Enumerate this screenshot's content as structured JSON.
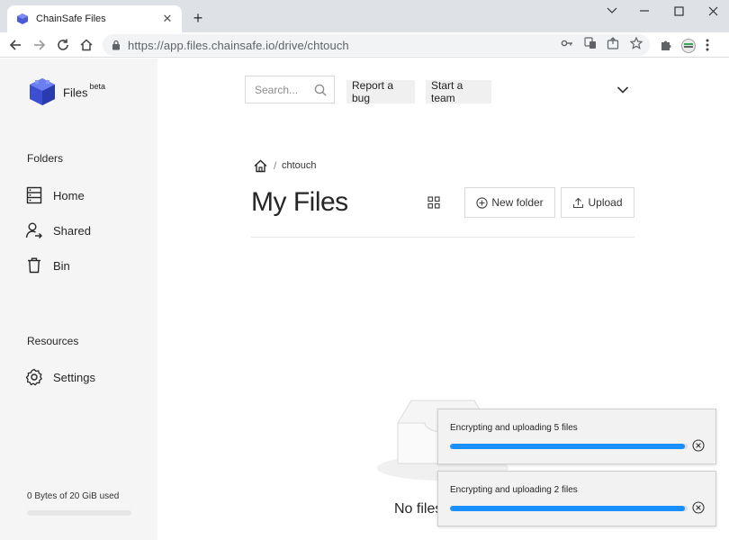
{
  "browser": {
    "tab_title": "ChainSafe Files",
    "tab_close": "✕",
    "new_tab": "+",
    "url": "https://app.files.chainsafe.io/drive/chtouch",
    "window_controls": [
      "minimize",
      "maximize",
      "close"
    ]
  },
  "sidebar": {
    "brand": "Files",
    "brand_badge": "beta",
    "folders_label": "Folders",
    "folders": [
      {
        "label": "Home",
        "icon": "home-list-icon"
      },
      {
        "label": "Shared",
        "icon": "shared-users-icon"
      },
      {
        "label": "Bin",
        "icon": "trash-icon"
      }
    ],
    "resources_label": "Resources",
    "settings_label": "Settings",
    "storage_text": "0 Bytes of 20 GiB used",
    "storage_fraction": 0
  },
  "header": {
    "search_placeholder": "Search...",
    "report_bug": "Report a bug",
    "start_team": "Start a team"
  },
  "content": {
    "breadcrumb_sep": "/",
    "breadcrumb_current": "chtouch",
    "title": "My Files",
    "new_folder": "New folder",
    "upload": "Upload",
    "empty_text": "No files"
  },
  "toasts": [
    {
      "message": "Encrypting and uploading 5 files",
      "progress": 0.99
    },
    {
      "message": "Encrypting and uploading 2 files",
      "progress": 0.99
    }
  ],
  "colors": {
    "accent": "#1890ff",
    "brand_cube": "#4a5bd8",
    "sidebar_bg": "#f5f5f5"
  }
}
